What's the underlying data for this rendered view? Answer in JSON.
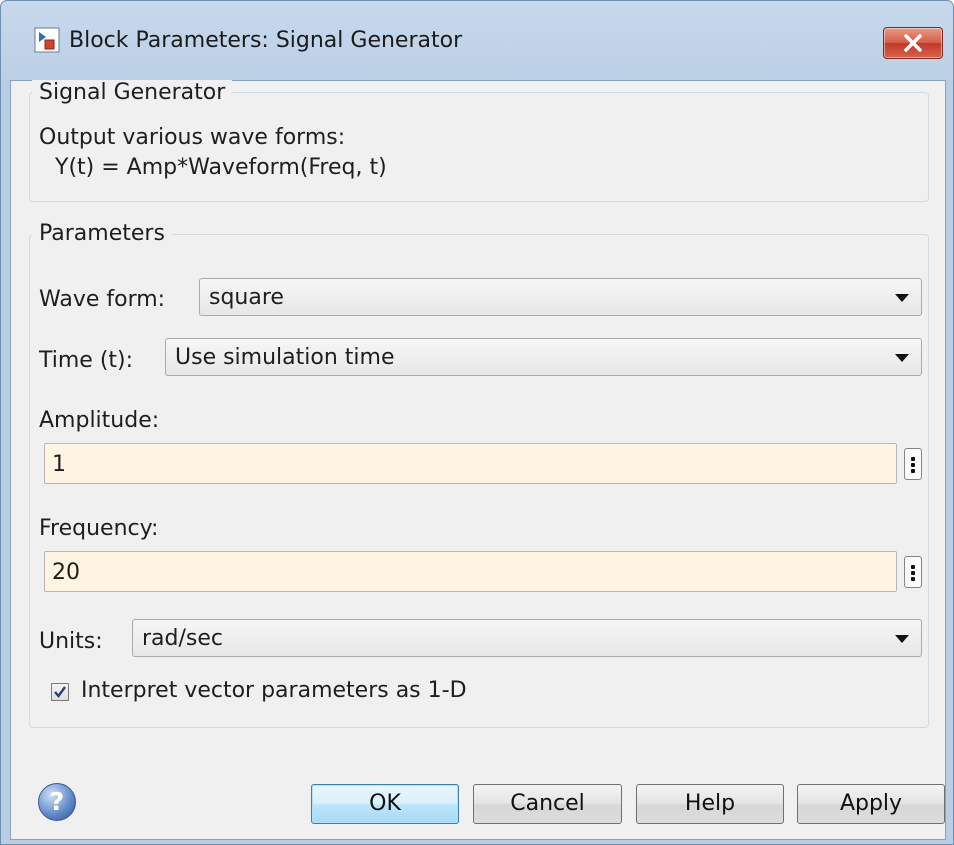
{
  "window": {
    "title": "Block Parameters: Signal Generator",
    "close_label": "×"
  },
  "description_group": {
    "legend": "Signal Generator",
    "line1": "Output various wave forms:",
    "line2": "Y(t) = Amp*Waveform(Freq, t)"
  },
  "parameters_group": {
    "legend": "Parameters",
    "wave_form": {
      "label": "Wave form:",
      "value": "square"
    },
    "time": {
      "label": "Time (t):",
      "value": "Use simulation time"
    },
    "amplitude": {
      "label": "Amplitude:",
      "value": "1"
    },
    "frequency": {
      "label": "Frequency:",
      "value": "20"
    },
    "units": {
      "label": "Units:",
      "value": "rad/sec"
    },
    "interpret_vector": {
      "label": "Interpret vector parameters as 1-D",
      "checked": true
    }
  },
  "buttons": {
    "help_icon": "?",
    "ok": "OK",
    "cancel": "Cancel",
    "help": "Help",
    "apply": "Apply"
  },
  "colors": {
    "titlebar": "#b9cde4",
    "dialog_bg": "#f0f0f0",
    "field_bg": "#fff3e1",
    "close_button": "#c0392b",
    "default_button": "#bee6fd"
  },
  "icons": {
    "app": "simulink-block-icon",
    "close": "close-icon",
    "help": "help-question-icon",
    "check": "checkmark-icon"
  }
}
